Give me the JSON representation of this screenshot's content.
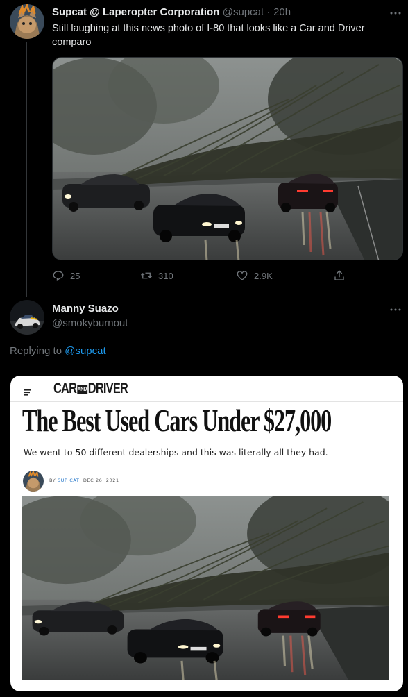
{
  "tweet1": {
    "display_name": "Supcat @ Laperopter Corporation",
    "handle": "@supcat",
    "separator": "·",
    "time": "20h",
    "text": "Still laughing at this news photo of I-80 that looks like a Car and Driver comparo",
    "more_icon": "more-horizontal-icon",
    "actions": {
      "reply_count": "25",
      "retweet_count": "310",
      "like_count": "2.9K"
    }
  },
  "tweet2": {
    "display_name": "Manny Suazo",
    "handle": "@smokyburnout",
    "replying_prefix": "Replying to",
    "replying_to": "@supcat",
    "more_icon": "more-horizontal-icon"
  },
  "article_card": {
    "logo_left": "CAR",
    "logo_amp": "AND",
    "logo_right": "DRIVER",
    "headline": "The Best Used Cars Under $27,000",
    "dek": "We went to 50 different dealerships and this was literally all they had.",
    "byline_prefix": "BY",
    "byline_author": "SUP CAT",
    "byline_date": "DEC 26, 2021"
  },
  "colors": {
    "background": "#000000",
    "text": "#e7e9ea",
    "muted": "#71767b",
    "link": "#1d9bf0"
  }
}
